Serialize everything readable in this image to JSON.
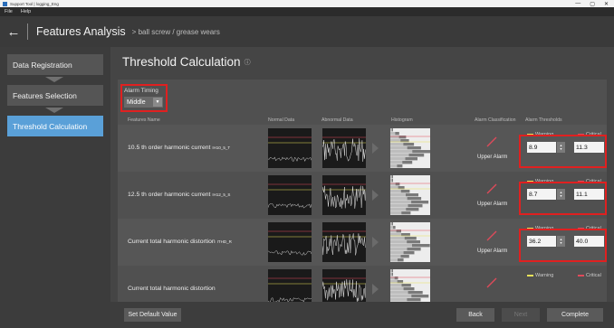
{
  "window": {
    "title": "Support Tool | logging_Eng",
    "controls": [
      "—",
      "▢",
      "✕"
    ]
  },
  "menu": {
    "items": [
      "File",
      "Help"
    ]
  },
  "header": {
    "title": "Features Analysis",
    "breadcrumb": "> ball screw / grease wears"
  },
  "sidebar": {
    "steps": [
      {
        "label": "Data Registration",
        "active": false
      },
      {
        "label": "Features Selection",
        "active": false
      },
      {
        "label": "Threshold Calculation",
        "active": true
      }
    ]
  },
  "main": {
    "title": "Threshold Calculation",
    "alarm_timing": {
      "label": "Alarm Timing",
      "value": "Middle"
    },
    "columns": {
      "feature": "Features Name",
      "normal": "Normal Data",
      "abnormal": "Abnormal Data",
      "histogram": "Histogram",
      "classification": "Alarm Classification",
      "thresholds": "Alarm Thresholds"
    },
    "rows": [
      {
        "name": "10.5 th order harmonic current",
        "sub": "IH10_5_T",
        "classification": "Upper Alarm",
        "warning_label": "Warning",
        "critical_label": "Critical",
        "warning": "8.9",
        "critical": "11.3"
      },
      {
        "name": "12.5 th order harmonic current",
        "sub": "IH12_5_S",
        "classification": "Upper Alarm",
        "warning_label": "Warning",
        "critical_label": "Critical",
        "warning": "8.7",
        "critical": "11.1"
      },
      {
        "name": "Current total harmonic distortion",
        "sub": "ITHD_R",
        "classification": "Upper Alarm",
        "warning_label": "Warning",
        "critical_label": "Critical",
        "warning": "36.2",
        "critical": "40.0"
      },
      {
        "name": "Current total harmonic distortion",
        "sub": "",
        "classification": "",
        "warning_label": "Warning",
        "critical_label": "Critical",
        "warning": "",
        "critical": ""
      }
    ]
  },
  "footer": {
    "default_button": "Set Default Value",
    "back_button": "Back",
    "next_button": "Next",
    "complete_button": "Complete"
  },
  "colors": {
    "accent": "#5aa0d8",
    "warning_line": "#e8e25a",
    "critical_line": "#e04a5a",
    "highlight_box": "#e02020"
  },
  "icons": {
    "back": "back-arrow-icon",
    "info": "info-icon",
    "dropdown": "chevron-down-icon",
    "alarm": "upper-alarm-icon"
  }
}
